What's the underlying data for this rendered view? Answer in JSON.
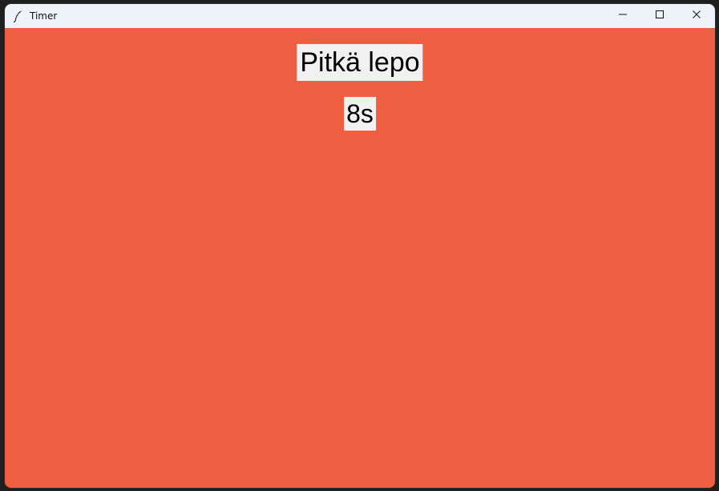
{
  "window": {
    "title": "Timer",
    "icon": "feather-icon",
    "controls": {
      "minimize_icon": "minimize-icon",
      "maximize_icon": "maximize-icon",
      "close_icon": "close-icon"
    }
  },
  "timer": {
    "mode": "Pitkä lepo",
    "remaining": "8s"
  },
  "colors": {
    "background": "#ee5f41",
    "label_background": "#f1f1f1",
    "titlebar": "#eef2f9"
  }
}
